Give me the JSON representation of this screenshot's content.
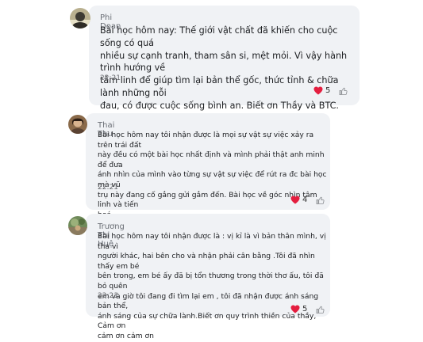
{
  "comments": [
    {
      "author": "Phi Doan",
      "text": "Bài học hôm nay: Thế giới vật chất đã khiến cho cuộc sống có quá\nnhiều sự cạnh tranh, tham sân si, mệt mỏi. Vì vậy hành trình hướng về\ntâm linh để giúp tìm lại bản thể gốc, thức tỉnh & chữa lành những nỗi\nđau, có được cuộc sống bình an. Biết ơn Thầy và BTC.",
      "time": "22:21",
      "reaction_count": "5",
      "reaction_icon": "heart-icon",
      "like_icon": "thumbs-up-icon"
    },
    {
      "author": "Thai Thu",
      "text": "Bài học hôm nay tôi nhận được là mọi sự vật sự việc xảy ra trên trái đất\nnày đều có một bài học nhất định và mình phải thật anh minh để đưa\nánh nhìn của mình vào từng sự vật sự việc để rút ra đc bài học mà vũ\ntrụ này đang cố gắng gửi gắm đến. Bài học về góc nhìn tâm linh và tiến\nhoá",
      "time": "22:21",
      "reaction_count": "4",
      "reaction_icon": "heart-icon",
      "like_icon": "thumbs-up-icon"
    },
    {
      "author": "Trương Thị Huệ",
      "text": "Bài học hôm nay tôi nhận được là : vị kỉ là vì bản thân mình, vị tha vì\nngười khác, hai bên cho và nhận phải cân bằng .Tôi đã nhìn thấy em bé\nbên trong, em bé ấy đã bị tổn thương trong thời thơ ấu, tôi đã bỏ quên\nem và giờ tôi đang đi tìm lại em , tôi đã nhận được ánh sáng bản thể,\nánh sáng của sự chữa lành.Biết ơn quy trình thiền của thầy, Cảm ơn\ncảm ơn cảm ơn",
      "time": "22:21",
      "reaction_count": "5",
      "reaction_icon": "heart-icon",
      "like_icon": "thumbs-up-icon"
    }
  ],
  "colors": {
    "bubble": "#f0f2f5",
    "heart": "#e41e3f",
    "text": "#1c1e21",
    "muted": "#65676b"
  }
}
